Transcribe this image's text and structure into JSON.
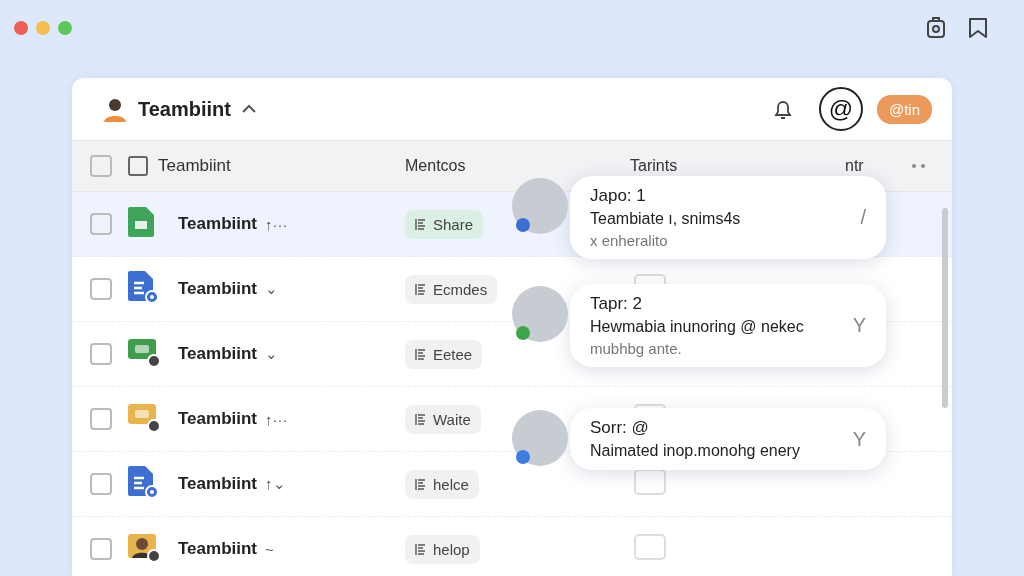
{
  "app": {
    "title": "Teambiint",
    "expanded": true,
    "badge": "@tin",
    "mention_button": "@"
  },
  "table": {
    "all_checked": false,
    "name_checked": false,
    "columns": [
      "Teambiint",
      "Mentcos",
      "Tarints",
      "ntr"
    ],
    "rows": [
      {
        "name": "Teambiint",
        "suffix": "↑···",
        "kind": "sheet",
        "color": "#3fa55a",
        "tag": "Share",
        "selected": true,
        "checked": false
      },
      {
        "name": "Teambiint",
        "suffix": "⌄",
        "kind": "doc",
        "color": "#3c6fd1",
        "tag": "Ecmdes",
        "selected": false,
        "checked": false
      },
      {
        "name": "Teambiint",
        "suffix": "⌄",
        "kind": "chat",
        "color": "#3f9d4c",
        "tag": "Eetee",
        "selected": false,
        "checked": false
      },
      {
        "name": "Teambiint",
        "suffix": "↑···",
        "kind": "chat",
        "color": "#e9b44c",
        "tag": "Waite",
        "selected": false,
        "checked": false
      },
      {
        "name": "Teambiint",
        "suffix": "↑⌄",
        "kind": "doc",
        "color": "#3c6fd1",
        "tag": "helce",
        "selected": false,
        "checked": false
      },
      {
        "name": "Teambiint",
        "suffix": "~",
        "kind": "avatar",
        "color": "#e9b44c",
        "tag": "helop",
        "selected": false,
        "checked": false
      }
    ]
  },
  "mentions": [
    {
      "title": "Japo: 1",
      "body": "Teambiate ı, snims4s",
      "note": "x enheralito",
      "mark": "/",
      "color": "#3c6fd1"
    },
    {
      "title": "Tapr: 2",
      "body": "Hewmabia inunoring @ nekec",
      "note": "mubhbg ante.",
      "mark": "Y",
      "color": "#3aa84a"
    },
    {
      "title": "Sorr: @",
      "body": "Naimated inop.monohg enery",
      "mark": "Y",
      "color": "#3c7ee0"
    }
  ]
}
